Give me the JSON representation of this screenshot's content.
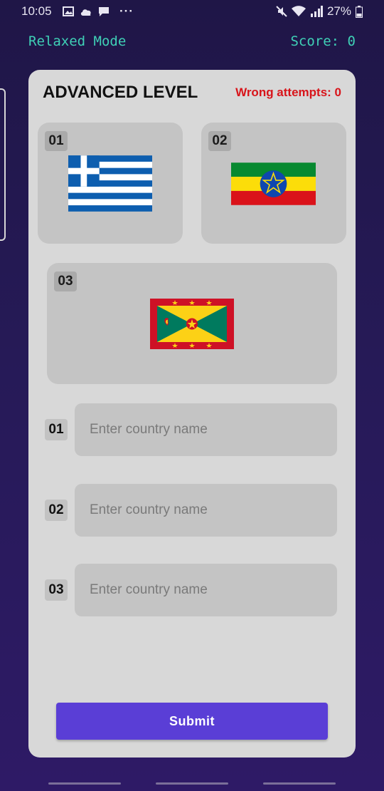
{
  "status_bar": {
    "time": "10:05",
    "battery": "27%",
    "more": "···"
  },
  "header": {
    "mode": "Relaxed Mode",
    "score": "Score: 0"
  },
  "card": {
    "title": "ADVANCED LEVEL",
    "wrong_attempts": "Wrong attempts: 0"
  },
  "flags": [
    {
      "number": "01",
      "flag": "greece-flag-icon"
    },
    {
      "number": "02",
      "flag": "ethiopia-flag-icon"
    },
    {
      "number": "03",
      "flag": "grenada-flag-icon"
    }
  ],
  "answers": [
    {
      "number": "01",
      "placeholder": "Enter country name",
      "value": ""
    },
    {
      "number": "02",
      "placeholder": "Enter country name",
      "value": ""
    },
    {
      "number": "03",
      "placeholder": "Enter country name",
      "value": ""
    }
  ],
  "submit_label": "Submit",
  "colors": {
    "accent": "#5a3ed6",
    "mode_text": "#3fd0b6",
    "error": "#d8141a",
    "card_bg": "#d8d8d8"
  }
}
